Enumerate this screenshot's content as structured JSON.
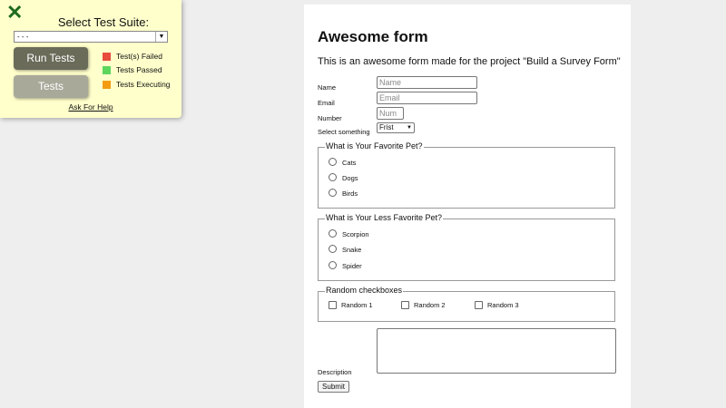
{
  "test_panel": {
    "close_glyph": "✕",
    "title": "Select Test Suite:",
    "suite_select_value": "- - -",
    "run_tests_label": "Run Tests",
    "tests_label": "Tests",
    "legend": [
      {
        "label": "Test(s) Failed",
        "color": "#e74c3c"
      },
      {
        "label": "Tests Passed",
        "color": "#5cd65c"
      },
      {
        "label": "Tests Executing",
        "color": "#f39c12"
      }
    ],
    "help_link": "Ask For Help"
  },
  "form": {
    "title": "Awesome form",
    "description": "This is an awesome form made for the project \"Build a Survey Form\"",
    "fields": {
      "name_label": "Name",
      "name_placeholder": "Name",
      "email_label": "Email",
      "email_placeholder": "Email",
      "number_label": "Number",
      "number_placeholder": "Num",
      "select_label": "Select something",
      "select_value": "Frist"
    },
    "favorite_pet": {
      "legend": "What is Your Favorite Pet?",
      "options": [
        "Cats",
        "Dogs",
        "Birds"
      ]
    },
    "less_favorite_pet": {
      "legend": "What is Your Less Favorite Pet?",
      "options": [
        "Scorpion",
        "Snake",
        "Spider"
      ]
    },
    "random_checkboxes": {
      "legend": "Random checkboxes",
      "options": [
        "Random 1",
        "Random 2",
        "Random 3"
      ]
    },
    "description_label": "Description",
    "submit_label": "Submit"
  },
  "colors": {
    "panel_bg": "#ffffcc",
    "page_bg": "#eeeeee",
    "run_button": "#6b6b5a",
    "tests_button": "#a9a99a",
    "close_icon": "#1e6b1e"
  }
}
